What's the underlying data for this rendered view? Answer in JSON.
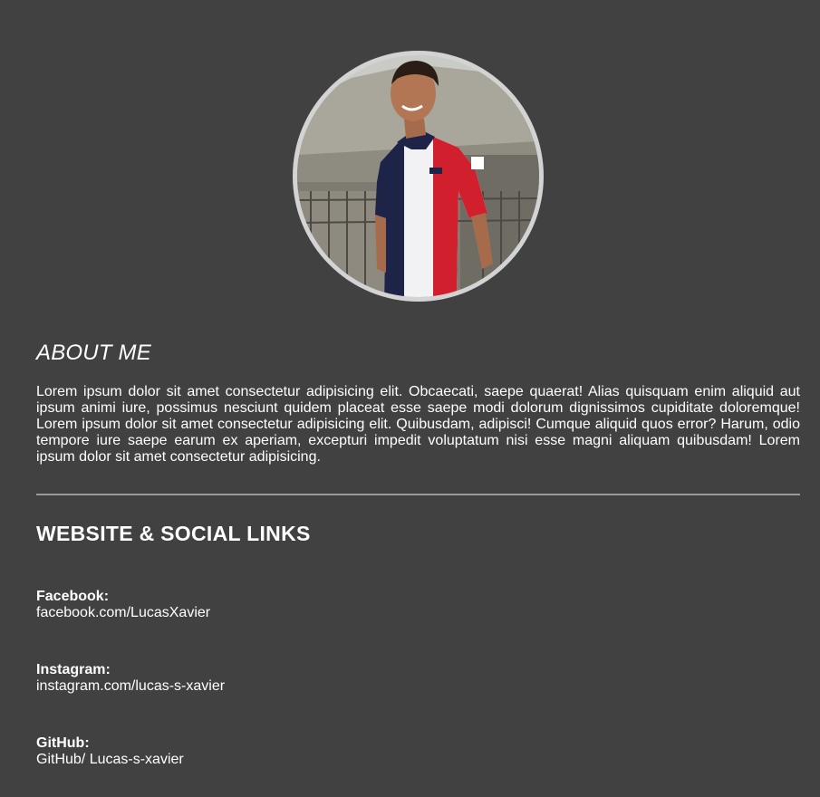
{
  "profile": {
    "photo_description": "profile-photo"
  },
  "about": {
    "title": "ABOUT ME",
    "text": "Lorem ipsum dolor sit amet consectetur adipisicing elit. Obcaecati, saepe quaerat! Alias quisquam enim aliquid aut ipsum animi iure, possimus nesciunt quidem placeat esse saepe modi dolorum dignissimos cupiditate doloremque! Lorem ipsum dolor sit amet consectetur adipisicing elit. Quibusdam, adipisci! Cumque aliquid quos error? Harum, odio tempore iure saepe earum ex aperiam, excepturi impedit voluptatum nisi esse magni aliquam quibusdam! Lorem ipsum dolor sit amet consectetur adipisicing."
  },
  "links": {
    "title": "WEBSITE & SOCIAL LINKS",
    "items": [
      {
        "label": "Facebook:",
        "value": "facebook.com/LucasXavier"
      },
      {
        "label": "Instagram:",
        "value": "instagram.com/lucas-s-xavier"
      },
      {
        "label": "GitHub:",
        "value": "GitHub/ Lucas-s-xavier"
      }
    ]
  },
  "colors": {
    "background": "#414141",
    "text": "#ffffff",
    "divider": "#9a9a9a",
    "avatar_ring": "#d3d3d3"
  }
}
